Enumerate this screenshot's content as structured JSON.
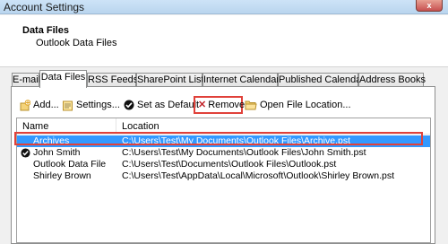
{
  "window": {
    "title": "Account Settings",
    "close_label": "x"
  },
  "header": {
    "title": "Data Files",
    "subtitle": "Outlook Data Files"
  },
  "tabs": [
    {
      "label": "E-mail"
    },
    {
      "label": "Data Files"
    },
    {
      "label": "RSS Feeds"
    },
    {
      "label": "SharePoint Lists"
    },
    {
      "label": "Internet Calendars"
    },
    {
      "label": "Published Calendars"
    },
    {
      "label": "Address Books"
    }
  ],
  "toolbar": {
    "add": "Add...",
    "settings": "Settings...",
    "set_default": "Set as Default",
    "remove": "Remove",
    "open_location": "Open File Location..."
  },
  "list": {
    "columns": {
      "name": "Name",
      "location": "Location"
    },
    "rows": [
      {
        "name": "Archives",
        "location": "C:\\Users\\Test\\My Documents\\Outlook Files\\Archive.pst"
      },
      {
        "name": "John Smith",
        "location": "C:\\Users\\Test\\My Documents\\Outlook Files\\John Smith.pst"
      },
      {
        "name": "Outlook Data File",
        "location": "C:\\Users\\Test\\Documents\\Outlook Files\\Outlook.pst"
      },
      {
        "name": "Shirley Brown",
        "location": "C:\\Users\\Test\\AppData\\Local\\Microsoft\\Outlook\\Shirley Brown.pst"
      }
    ]
  },
  "colors": {
    "selection": "#3399ff",
    "highlight_box": "#e0413a"
  }
}
